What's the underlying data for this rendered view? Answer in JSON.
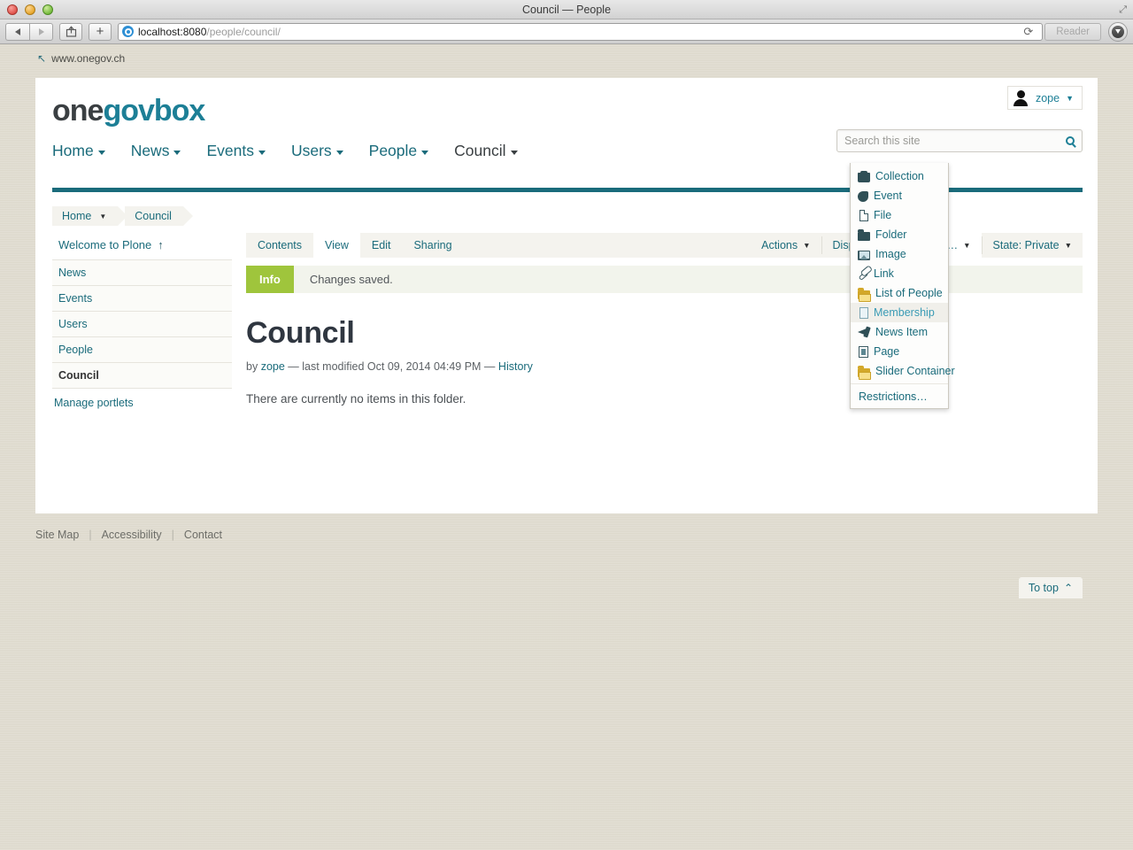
{
  "browser": {
    "window_title": "Council — People",
    "url_host": "localhost:8080",
    "url_path": "/people/council/",
    "reader_label": "Reader",
    "back_icon": "back-arrow-icon",
    "forward_icon": "forward-arrow-icon",
    "share_icon": "share-icon",
    "new_tab_icon": "plus-icon",
    "reload_icon": "reload-icon",
    "downloads_icon": "downloads-icon",
    "fullscreen_icon": "fullscreen-arrows-icon"
  },
  "edit_bar": {
    "site_label": "www.onegov.ch",
    "icon": "back-up-arrow-icon"
  },
  "site": {
    "logo": {
      "part1": "one",
      "part2": "govbox"
    },
    "user_menu": {
      "name": "zope",
      "avatar_icon": "user-avatar-icon",
      "caret": "▼"
    },
    "nav": [
      {
        "label": "Home",
        "active": false
      },
      {
        "label": "News",
        "active": false
      },
      {
        "label": "Events",
        "active": false
      },
      {
        "label": "Users",
        "active": false
      },
      {
        "label": "People",
        "active": false
      },
      {
        "label": "Council",
        "active": true
      }
    ],
    "search": {
      "placeholder": "Search this site",
      "value": "",
      "icon": "search-icon"
    },
    "breadcrumb": [
      {
        "label": "Home",
        "has_caret": true
      },
      {
        "label": "Council",
        "has_caret": false
      }
    ],
    "sidebar": {
      "portlet_title": "Welcome to Plone",
      "portlet_title_icon": "up-arrow-icon",
      "items": [
        {
          "label": "News",
          "current": false
        },
        {
          "label": "Events",
          "current": false
        },
        {
          "label": "Users",
          "current": false
        },
        {
          "label": "People",
          "current": false
        },
        {
          "label": "Council",
          "current": true
        }
      ],
      "manage_portlets": "Manage portlets"
    },
    "content_tabs": {
      "left": [
        {
          "label": "Contents",
          "selected": false
        },
        {
          "label": "View",
          "selected": true
        },
        {
          "label": "Edit",
          "selected": false
        },
        {
          "label": "Sharing",
          "selected": false
        }
      ],
      "right": [
        {
          "label": "Actions",
          "selected": false,
          "caret": "▼"
        },
        {
          "label": "Display",
          "selected": false,
          "caret": "▼"
        },
        {
          "label": "Add new…",
          "selected": true,
          "caret": "▼"
        },
        {
          "label": "State: Private",
          "selected": false,
          "caret": "▼"
        }
      ]
    },
    "status": {
      "badge": "Info",
      "message": "Changes saved.",
      "badge_color": "#9fc53c"
    },
    "page": {
      "title": "Council",
      "byline_prefix": "by",
      "author": "zope",
      "byline_mid": "— last modified Oct 09, 2014 04:49 PM —",
      "history_label": "History",
      "body": "There are currently no items in this folder."
    },
    "to_top": {
      "label": "To top",
      "icon": "chevron-up-icon"
    },
    "add_new_menu": [
      {
        "label": "Collection",
        "icon": "collection-icon",
        "hover": false
      },
      {
        "label": "Event",
        "icon": "event-icon",
        "hover": false
      },
      {
        "label": "File",
        "icon": "file-icon",
        "hover": false
      },
      {
        "label": "Folder",
        "icon": "folder-icon",
        "hover": false
      },
      {
        "label": "Image",
        "icon": "image-icon",
        "hover": false
      },
      {
        "label": "Link",
        "icon": "link-icon",
        "hover": false
      },
      {
        "label": "List of People",
        "icon": "yellow-folder-icon",
        "hover": false
      },
      {
        "label": "Membership",
        "icon": "document-icon",
        "hover": true
      },
      {
        "label": "News Item",
        "icon": "megaphone-icon",
        "hover": false
      },
      {
        "label": "Page",
        "icon": "page-icon",
        "hover": false
      },
      {
        "label": "Slider Container",
        "icon": "yellow-folder-icon",
        "hover": false
      },
      {
        "label": "Restrictions…",
        "icon": "none",
        "hover": false
      }
    ],
    "footer": [
      {
        "label": "Site Map"
      },
      {
        "label": "Accessibility"
      },
      {
        "label": "Contact"
      }
    ]
  },
  "colors": {
    "teal": "#1a6b7b",
    "teal_bright": "#1d7f96",
    "green": "#9fc53c",
    "page_bg": "#dcd8cb"
  }
}
